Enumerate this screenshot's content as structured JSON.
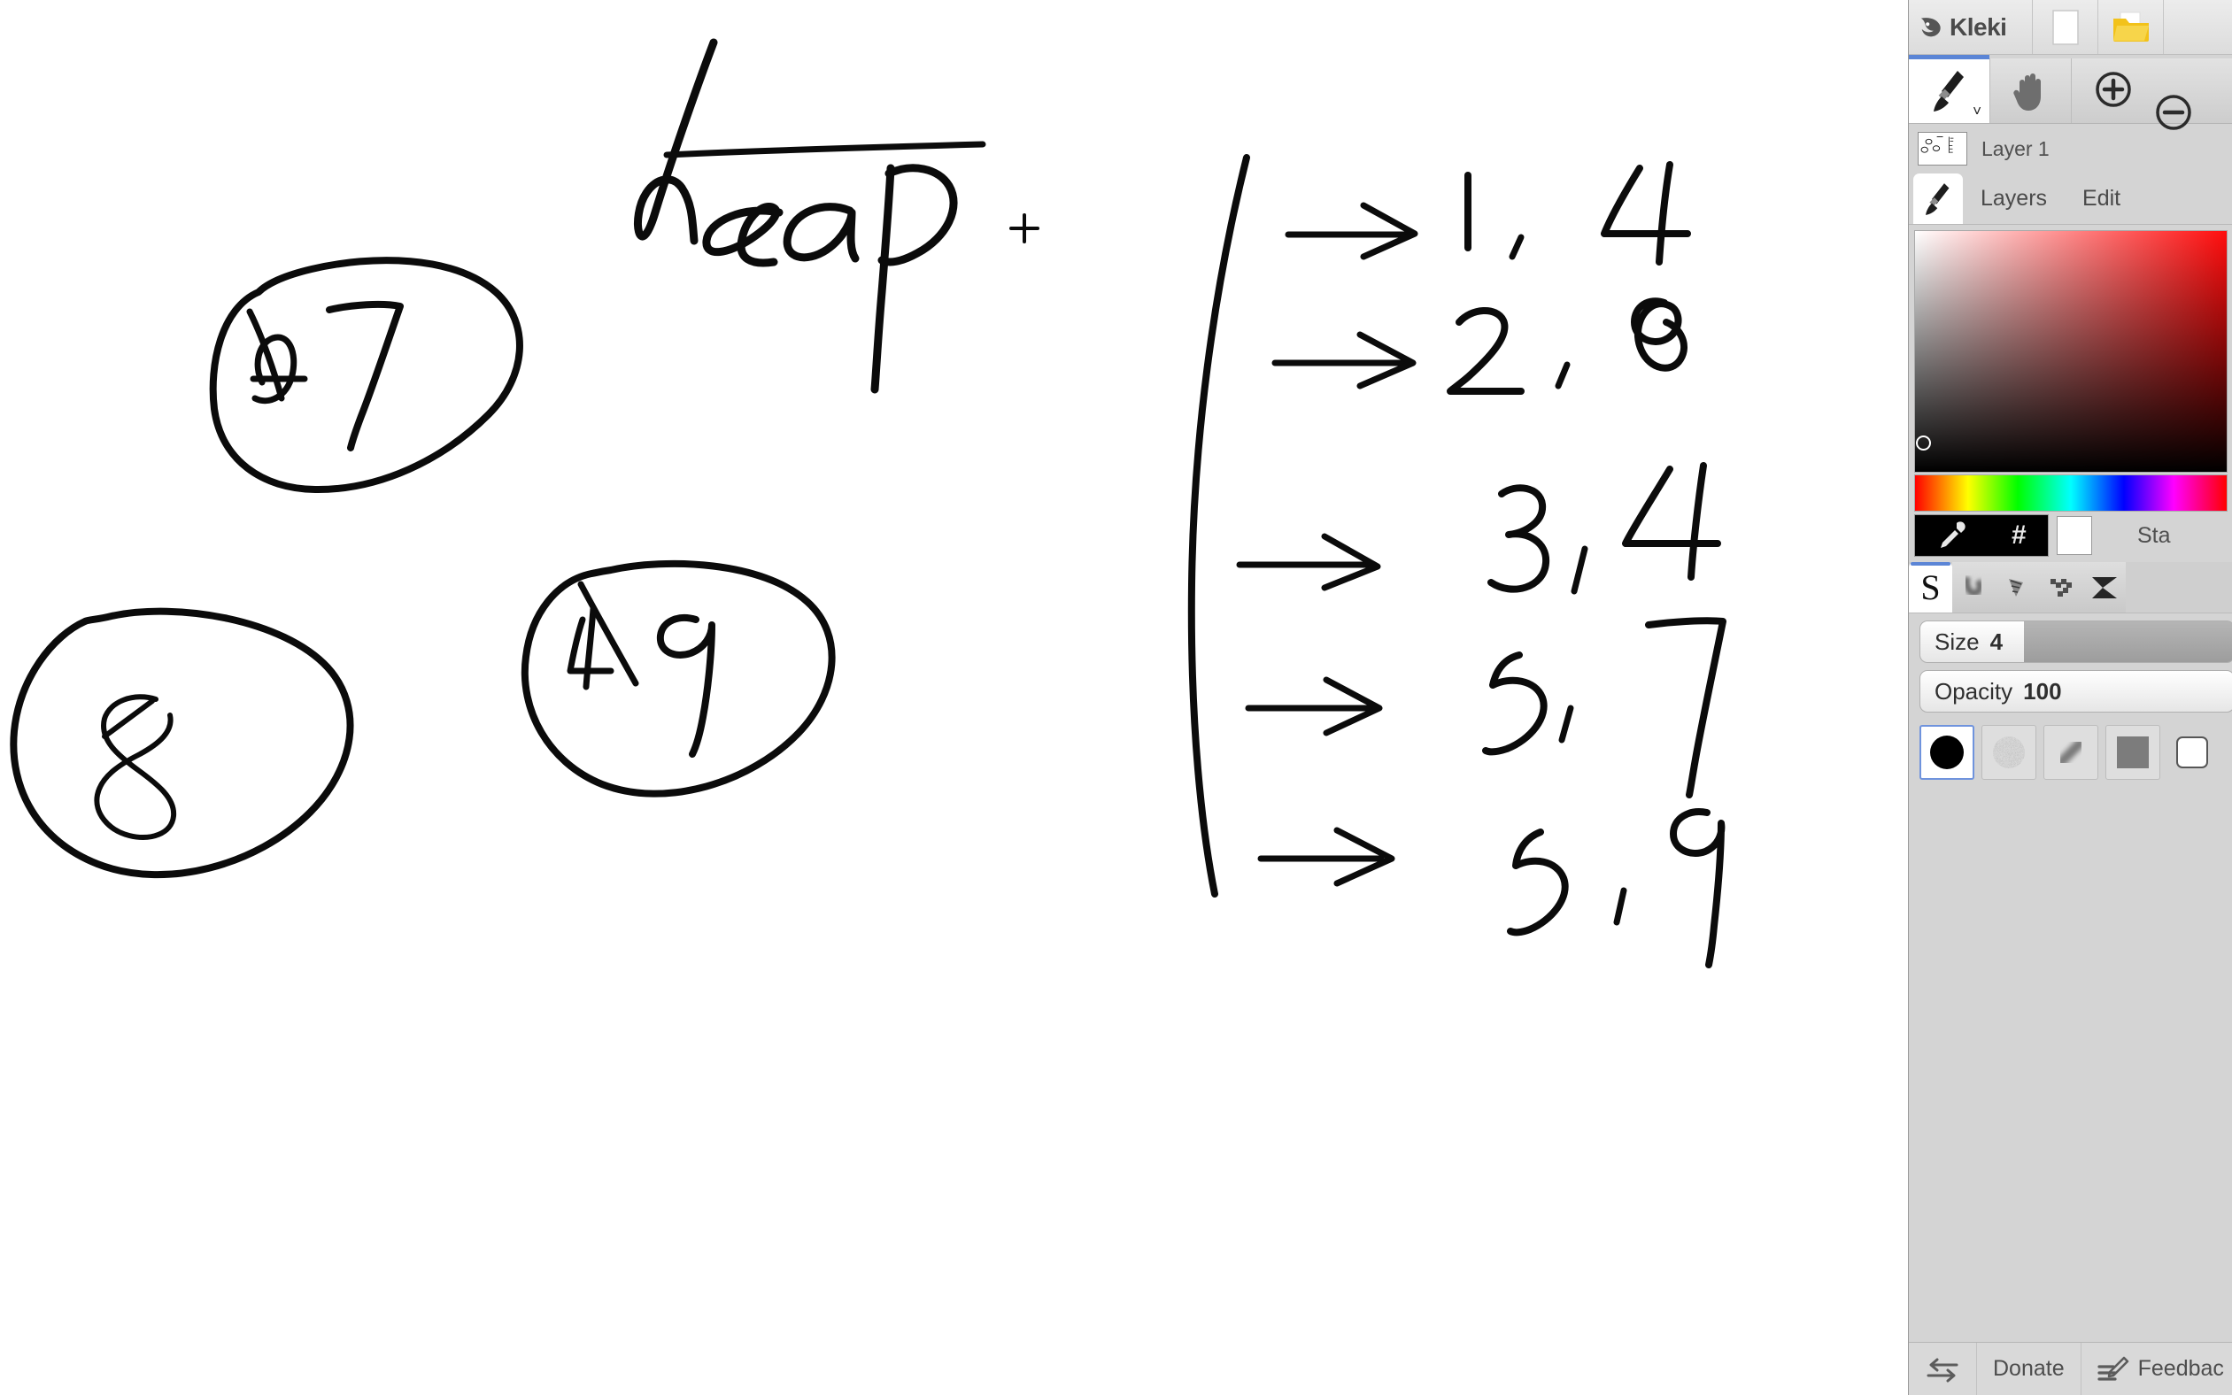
{
  "app": {
    "name": "Kleki"
  },
  "titlebar": {
    "new_icon": "new-file-icon",
    "open_icon": "open-folder-icon"
  },
  "tools": [
    {
      "name": "brush-tool",
      "icon": "paintbrush-icon",
      "active": true,
      "caret": "˅"
    },
    {
      "name": "hand-tool",
      "icon": "hand-icon",
      "active": false
    },
    {
      "name": "zoom-in",
      "icon": "plus-circle-icon",
      "active": false
    },
    {
      "name": "zoom-out",
      "icon": "minus-circle-icon",
      "active": false
    }
  ],
  "layer": {
    "name": "Layer 1",
    "thumbnail": "layer-thumbnail"
  },
  "tabs": {
    "brush_tab_icon": "paintbrush-icon",
    "layers": "Layers",
    "edit": "Edit"
  },
  "color": {
    "primary": "#000000",
    "secondary": "#ffffff",
    "hue": "#ff0d0d",
    "eyedropper_icon": "eyedropper-icon",
    "hex_icon": "#",
    "stack_label": "Sta"
  },
  "brush_kinds": [
    {
      "name": "brush-kind-pen",
      "glyph": "S",
      "active": true
    },
    {
      "name": "brush-kind-blend",
      "glyph": "blur-stroke-icon",
      "active": false
    },
    {
      "name": "brush-kind-sketchy",
      "glyph": "chalk-icon",
      "active": false
    },
    {
      "name": "brush-kind-pixel",
      "glyph": "pixel-icon",
      "active": false
    },
    {
      "name": "brush-kind-eraser",
      "glyph": "bowtie-icon",
      "active": false
    }
  ],
  "sliders": {
    "size": {
      "label": "Size",
      "value": "4",
      "fill_percent": 33
    },
    "opacity": {
      "label": "Opacity",
      "value": "100",
      "fill_percent": 100
    }
  },
  "brush_tips": [
    {
      "name": "tip-solid",
      "active": true
    },
    {
      "name": "tip-noise",
      "active": false
    },
    {
      "name": "tip-soft",
      "active": false
    },
    {
      "name": "tip-square",
      "active": false
    }
  ],
  "bottombar": {
    "swap_icon": "swap-arrows-icon",
    "donate": "Donate",
    "feedback_icon": "feedback-pencil-icon",
    "feedback": "Feedbac"
  },
  "canvas": {
    "title_word": "heap",
    "cursor": "crosshair-cursor",
    "circled_nodes": [
      {
        "name": "node-7",
        "crossed": "4",
        "value": "7"
      },
      {
        "name": "node-8",
        "crossed": "",
        "value": "8"
      },
      {
        "name": "node-9",
        "crossed": "4",
        "value": "9"
      }
    ],
    "pairs": [
      {
        "left": "1",
        "right": "4"
      },
      {
        "left": "2",
        "right": "8"
      },
      {
        "left": "3",
        "right": "4"
      },
      {
        "left": "5",
        "right": "7"
      },
      {
        "left": "5",
        "right": "9"
      }
    ]
  }
}
